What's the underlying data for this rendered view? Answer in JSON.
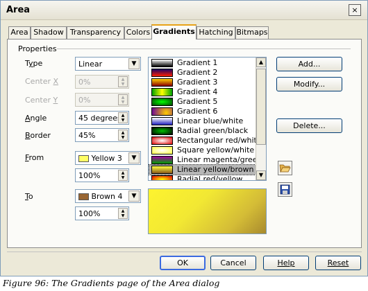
{
  "window": {
    "title": "Area",
    "close_glyph": "×"
  },
  "tabs": [
    {
      "label": "Area"
    },
    {
      "label": "Shadow"
    },
    {
      "label": "Transparency"
    },
    {
      "label": "Colors"
    },
    {
      "label": "Gradients"
    },
    {
      "label": "Hatching"
    },
    {
      "label": "Bitmaps"
    }
  ],
  "active_tab": "Gradients",
  "properties": {
    "group_label": "Properties",
    "type": {
      "label_pre": "T",
      "label_u": "y",
      "label_post": "pe",
      "value": "Linear"
    },
    "center_x": {
      "label_pre": "Center ",
      "label_u": "X",
      "value": "0%"
    },
    "center_y": {
      "label_pre": "Center ",
      "label_u": "Y",
      "value": "0%"
    },
    "angle": {
      "label_pre": "",
      "label_u": "A",
      "label_post": "ngle",
      "value": "45 degrees"
    },
    "border": {
      "label_pre": "",
      "label_u": "B",
      "label_post": "order",
      "value": "45%"
    },
    "from": {
      "label_pre": "",
      "label_u": "F",
      "label_post": "rom",
      "color_name": "Yellow 3",
      "color": "#ffff66",
      "intensity": "100%"
    },
    "to": {
      "label_pre": "",
      "label_u": "T",
      "label_post": "o",
      "color_name": "Brown 4",
      "color": "#996633",
      "intensity": "100%"
    }
  },
  "gradients": [
    {
      "name": "Gradient 1"
    },
    {
      "name": "Gradient 2"
    },
    {
      "name": "Gradient 3"
    },
    {
      "name": "Gradient 4"
    },
    {
      "name": "Gradient 5"
    },
    {
      "name": "Gradient 6"
    },
    {
      "name": "Linear blue/white"
    },
    {
      "name": "Radial green/black"
    },
    {
      "name": "Rectangular red/white"
    },
    {
      "name": "Square yellow/white"
    },
    {
      "name": "Linear magenta/green"
    },
    {
      "name": "Linear yellow/brown"
    },
    {
      "name": "Radial red/yellow"
    }
  ],
  "selected_gradient": "Linear yellow/brown",
  "side_buttons": {
    "add": "Add...",
    "modify": "Modify...",
    "delete": "Delete..."
  },
  "icons": {
    "load": "folder-open-icon",
    "save": "save-disk-icon"
  },
  "footer_buttons": {
    "ok": "OK",
    "cancel": "Cancel",
    "help": "Help",
    "reset": "Reset"
  },
  "caption": "Figure 96: The Gradients page of the Area dialog"
}
